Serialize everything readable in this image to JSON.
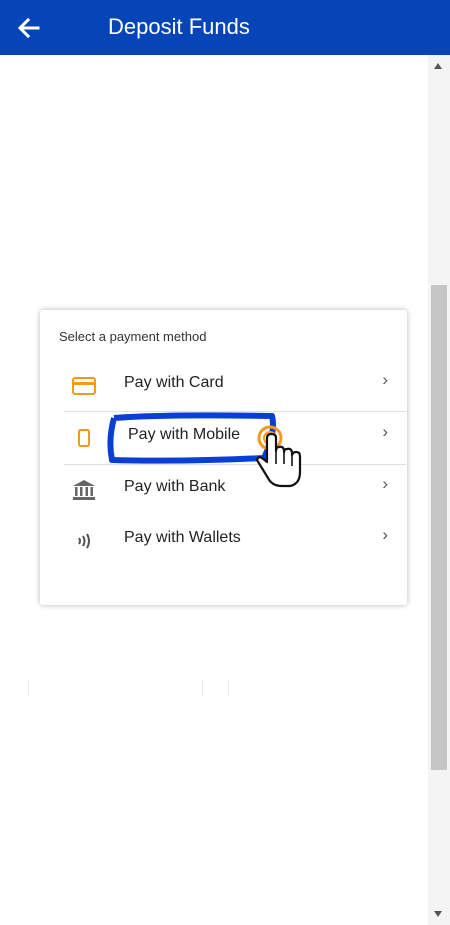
{
  "header": {
    "title": "Deposit Funds",
    "back_icon": "arrow-left-icon",
    "background": "#0645b8"
  },
  "payment": {
    "heading": "Select a payment method",
    "accent": "#f29a1f",
    "options": [
      {
        "label": "Pay with Card",
        "icon": "credit-card-icon"
      },
      {
        "label": "Pay with Mobile",
        "icon": "mobile-phone-icon"
      },
      {
        "label": "Pay with Bank",
        "icon": "bank-icon"
      },
      {
        "label": "Pay with Wallets",
        "icon": "contactless-icon"
      }
    ]
  },
  "annotation": {
    "highlight_color": "#0a3fd6",
    "cursor_icon": "pointing-hand-icon"
  }
}
